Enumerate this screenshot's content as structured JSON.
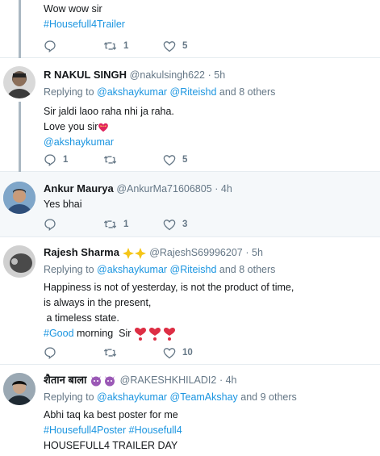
{
  "tweets": [
    {
      "lines": [
        "Wow wow sir"
      ],
      "hashtags": [
        "#Housefull4Trailer"
      ],
      "reply_count": "",
      "retweet_count": "1",
      "like_count": "5"
    },
    {
      "name": "R NAKUL SINGH",
      "handle": "@nakulsingh622",
      "time": "· 5h",
      "replying_prefix": "Replying to",
      "mentions": [
        "@akshaykumar",
        "@Riteishd"
      ],
      "others": "and 8 others",
      "lines": [
        "Sir jaldi laoo raha nhi ja raha.",
        "Love you sir"
      ],
      "mention_line": "@akshaykumar",
      "reply_count": "1",
      "retweet_count": "",
      "like_count": "5"
    },
    {
      "name": "Ankur Maurya",
      "handle": "@AnkurMa71606805",
      "time": "· 4h",
      "lines": [
        "Yes bhai"
      ],
      "reply_count": "",
      "retweet_count": "1",
      "like_count": "3"
    },
    {
      "name": "Rajesh Sharma",
      "handle": "@RajeshS69996207",
      "time": "· 5h",
      "replying_prefix": "Replying to",
      "mentions": [
        "@akshaykumar",
        "@Riteishd"
      ],
      "others": "and 8 others",
      "lines": [
        "Happiness is not of yesterday, is not the product of time,",
        "is always in the present,",
        " a timeless state."
      ],
      "hashtag_line": {
        "tag": "#Good",
        "rest": " morning  Sir "
      },
      "reply_count": "",
      "retweet_count": "",
      "like_count": "10"
    },
    {
      "name": "शैतान बाला",
      "handle": "@RAKESHKHILADI2",
      "time": "· 4h",
      "replying_prefix": "Replying to",
      "mentions": [
        "@akshaykumar",
        "@TeamAkshay"
      ],
      "others": "and 9 others",
      "lines": [
        "Abhi taq ka best poster for me"
      ],
      "hashtags": [
        "#Housefull4Poster",
        "#Housefull4"
      ],
      "last_line": "HOUSEFULL4 TRAILER DAY"
    }
  ],
  "colors": {
    "link": "#1b95e0",
    "muted": "#657786",
    "thread_line": "#aab8c2",
    "highlight_bg": "#f5f8fa",
    "heart_red": "#e0245e",
    "sparkle": "#f5c518",
    "devil_purple": "#9b59b6"
  },
  "icons": [
    "reply-icon",
    "retweet-icon",
    "like-icon",
    "heart-with-ribbon-emoji",
    "sparkles-emoji",
    "heart-exclamation-emoji",
    "smiling-devil-emoji"
  ]
}
